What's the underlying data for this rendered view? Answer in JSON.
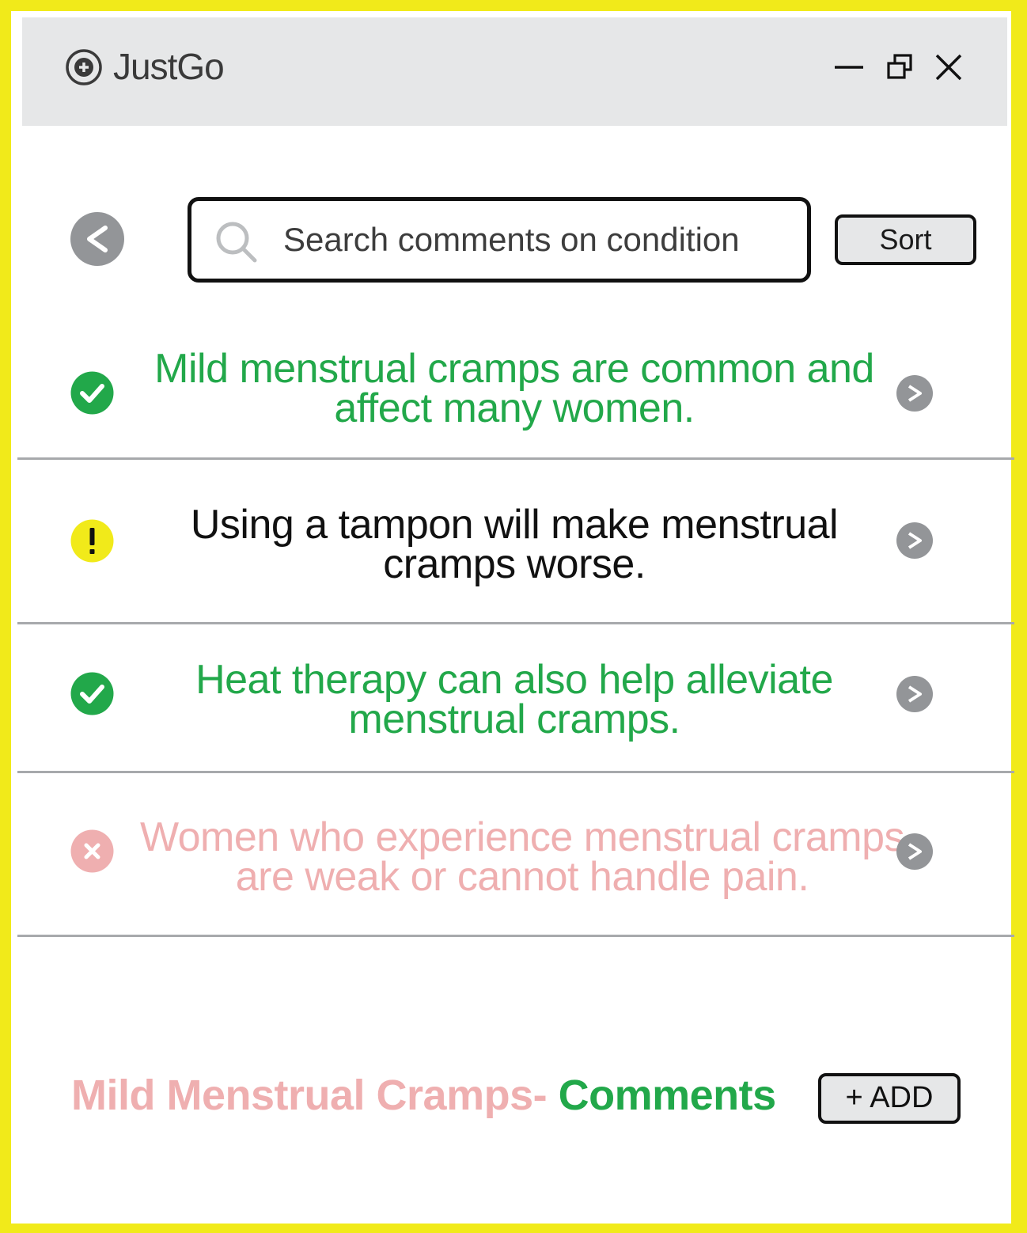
{
  "app": {
    "title": "JustGo",
    "logo_icon": "circle-plus-icon"
  },
  "window_controls": {
    "minimize_icon": "minimize-icon",
    "restore_icon": "restore-icon",
    "close_icon": "close-icon"
  },
  "toolbar": {
    "back_icon": "chevron-left-icon",
    "back_symbol": "<",
    "search_placeholder": "Search comments on condition",
    "search_icon": "search-icon",
    "sort_label": "Sort"
  },
  "comments": [
    {
      "status": "verified",
      "status_icon": "check-circle-icon",
      "color": "#22a84a",
      "text": "Mild menstrual cramps are common and affect many women."
    },
    {
      "status": "warning",
      "status_icon": "exclamation-circle-icon",
      "color": "#111111",
      "text": "Using a tampon will make menstrual cramps worse."
    },
    {
      "status": "verified",
      "status_icon": "check-circle-icon",
      "color": "#22a84a",
      "text": "Heat therapy can also help alleviate menstrual cramps."
    },
    {
      "status": "rejected",
      "status_icon": "x-circle-icon",
      "color": "#efafb0",
      "text": "Women who experience menstrual cramps are weak or cannot handle pain."
    }
  ],
  "row_chevron_symbol": ">",
  "footer": {
    "condition_label": "Mild Menstrual Cramps- ",
    "comments_label": "Comments",
    "add_label": "+ ADD"
  },
  "colors": {
    "frame": "#f1ea1a",
    "titlebar": "#e6e7e8",
    "green": "#22a84a",
    "yellow": "#f1ea1a",
    "pink": "#efafb0",
    "grey": "#939598"
  }
}
